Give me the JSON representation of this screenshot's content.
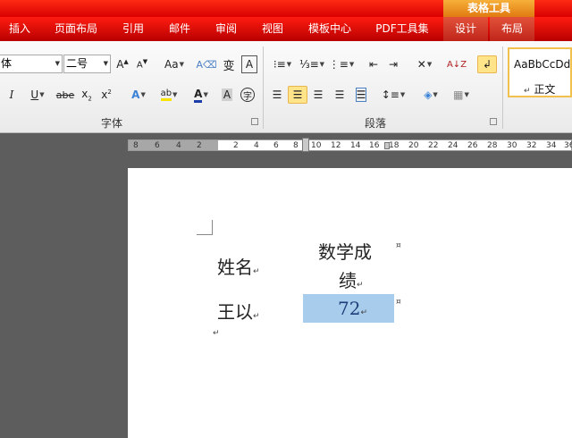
{
  "context_tab_title": "表格工具",
  "tabs": [
    "插入",
    "页面布局",
    "引用",
    "邮件",
    "审阅",
    "视图",
    "模板中心",
    "PDF工具集",
    "设计",
    "布局"
  ],
  "font_group": {
    "font_name": "体",
    "font_size": "二号",
    "label": "字体"
  },
  "paragraph_group": {
    "label": "段落"
  },
  "style_gallery": {
    "sample": "AaBbCcDd",
    "name": "正文"
  },
  "ruler_labels": [
    "8",
    "6",
    "4",
    "2",
    "2",
    "4",
    "6",
    "8",
    "10",
    "12",
    "14",
    "16",
    "18",
    "20",
    "22",
    "24",
    "26",
    "28",
    "30",
    "32",
    "34",
    "36"
  ],
  "table": {
    "header": [
      "姓名",
      "数学成",
      "绩"
    ],
    "row": [
      "王以",
      "72"
    ]
  },
  "colors": {
    "accent_red": "#e00000",
    "selection": "#a8ccec",
    "highlight": "#ffe48a"
  }
}
